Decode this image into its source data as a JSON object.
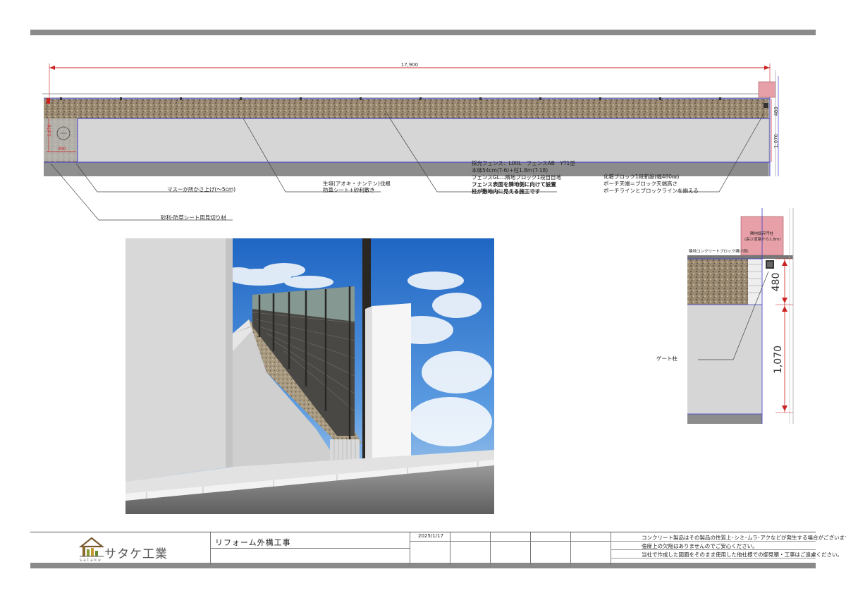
{
  "plan": {
    "total_width_dim": "17,900",
    "height_dim_top": "480",
    "height_dim_main": "1,070",
    "left_dim_h": "1,070",
    "left_dim_w": "300"
  },
  "annotations": {
    "masu": "マスーか所かさ上げ(〜5cm)",
    "plant_line1": "生垣(アオキ・ナンテン)伐根",
    "plant_line2": "防草シート+砂利敷き",
    "fence_line1": "採光フェンス：LIXIL　フェンスAB　YT1型",
    "fence_line2": "本体54cm(T-6)+柱1.8m(T-18)",
    "fence_line3": "フェンスGL…隣地ブロック1段目目地",
    "fence_line4": "フェンス表面を隣地側に向けて設置",
    "fence_line5": "柱が敷地内に見える施工です",
    "block_line1": "化粧ブロック1段新設(幅480㎜)",
    "block_line2": "ポーチ天端＝ブロック天端高さ",
    "block_line3": "ポーチラインとブロックラインを揃える",
    "gravel_cut": "砂利-防草シート用見切り材"
  },
  "section": {
    "pink_label_1": "隣地既存門柱",
    "pink_label_2": "(高さ道路から1.8m)",
    "block_label": "隣地コンクリートブロック塀(7段)",
    "dim_480": "480",
    "dim_1070": "1,070",
    "gate_label": "ゲート柱"
  },
  "title_block": {
    "company": "サタケ工業",
    "company_sub": "satake",
    "project": "リフォーム外構工事",
    "date": "2025/1/17",
    "note_1": "コンクリート製品はその製品の性質上･シミ･ムラ･アクなどが発生する場合がございます。",
    "note_2": "強度上の欠陥はありませんのでご安心ください。",
    "note_3": "当社で作成した図面をそのまま使用した他社様での御見積・工事はご遠慮ください。"
  },
  "colors": {
    "gravel": "#9a8a72",
    "concrete": "#d6d6d6",
    "dim_red": "#cc2222",
    "plan_line": "#3a3ad0",
    "pink_post": "#e8a0a8",
    "sky": "#3f84d6",
    "frame_bar": "#8a8a8a"
  }
}
